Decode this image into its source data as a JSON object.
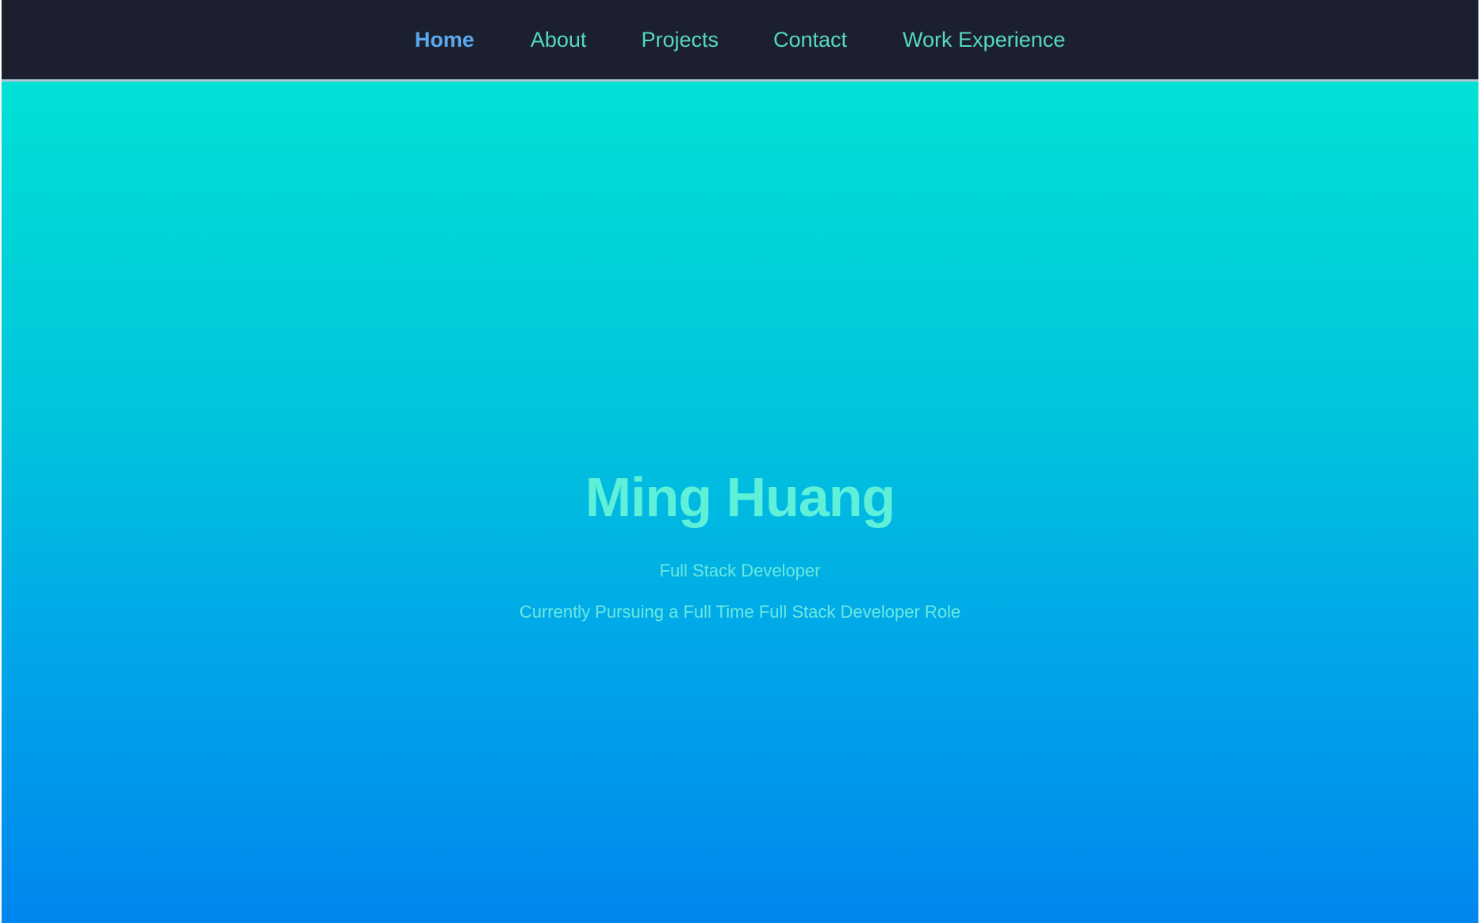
{
  "nav": {
    "items": [
      {
        "label": "Home",
        "active": true
      },
      {
        "label": "About",
        "active": false
      },
      {
        "label": "Projects",
        "active": false
      },
      {
        "label": "Contact",
        "active": false
      },
      {
        "label": "Work Experience",
        "active": false
      }
    ]
  },
  "hero": {
    "name": "Ming Huang",
    "role": "Full Stack Developer",
    "status": "Currently Pursuing a Full Time Full Stack Developer Role"
  },
  "colors": {
    "navbar_bg": "#1c1f2d",
    "nav_link": "#54d8c4",
    "nav_active": "#5aaaf0",
    "hero_gradient_top": "#00e0d6",
    "hero_gradient_bottom": "#0086ef",
    "hero_text": "#5ef0d8"
  }
}
